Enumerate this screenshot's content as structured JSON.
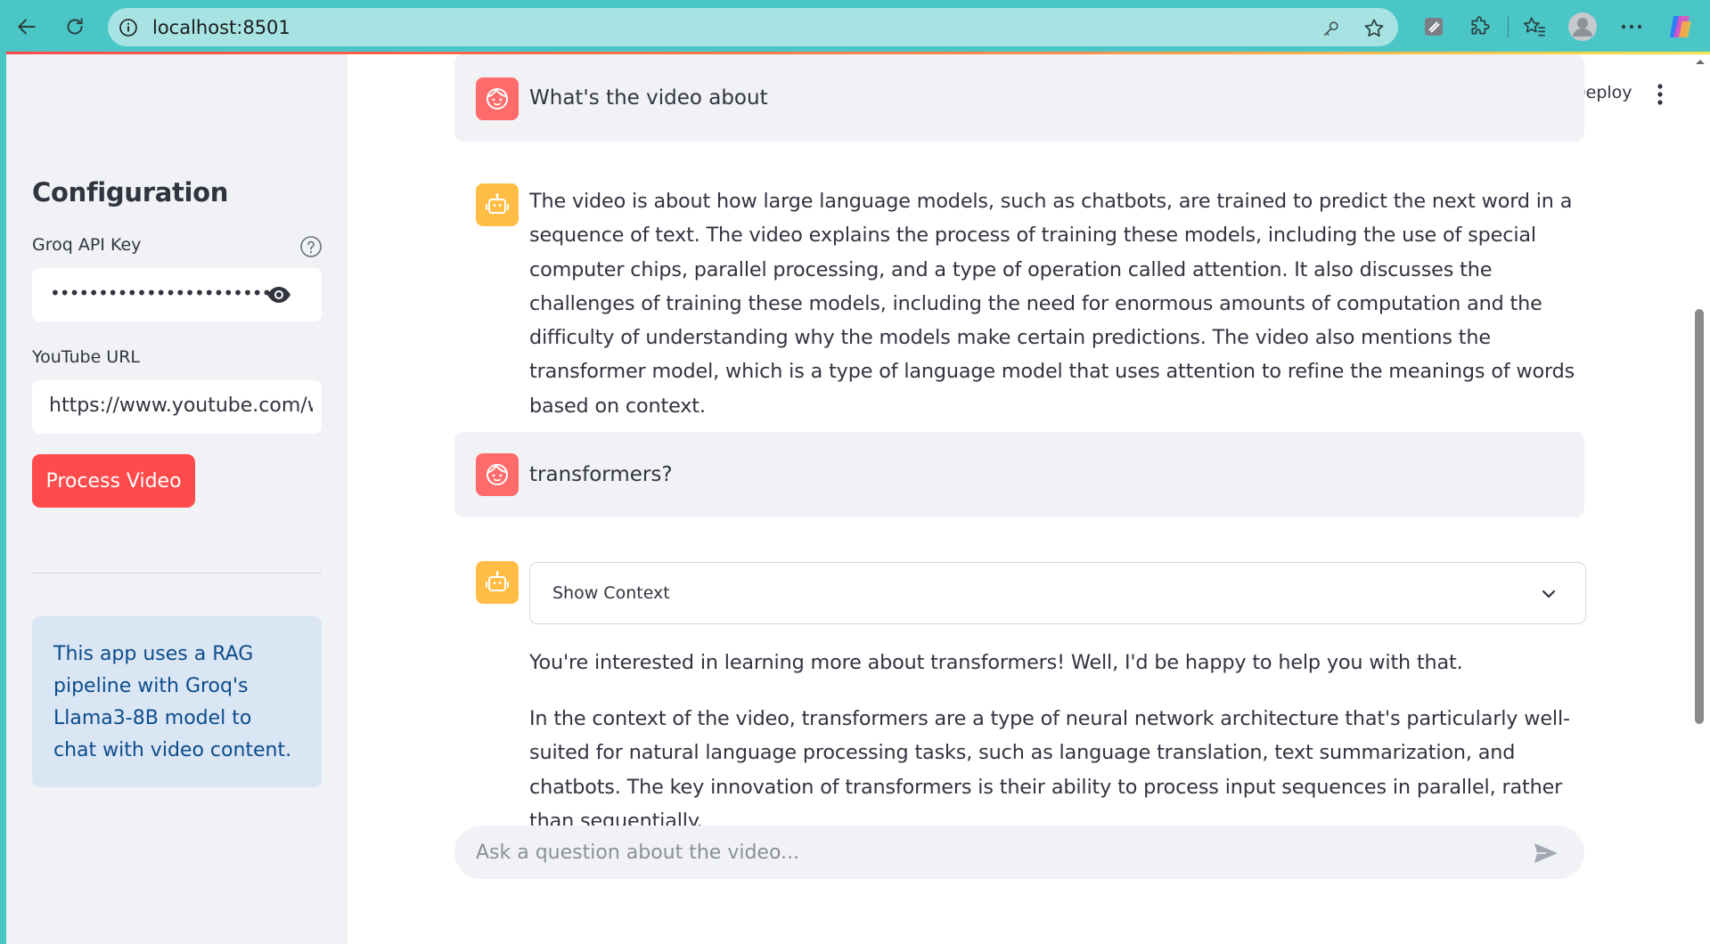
{
  "browser": {
    "url": "localhost:8501"
  },
  "sidebar": {
    "title": "Configuration",
    "api_key_label": "Groq API Key",
    "api_key_value": "••••••••••••••••••••••••••••••••••••••••",
    "youtube_label": "YouTube URL",
    "youtube_value": "https://www.youtube.com/watch?v=",
    "process_button": "Process Video",
    "info_text": "This app uses a RAG pipeline with Groq's Llama3-8B model to chat with video content."
  },
  "header": {
    "deploy": "Deploy"
  },
  "chat": {
    "messages": [
      {
        "role": "user",
        "text": "What's the video about"
      },
      {
        "role": "assistant",
        "text": "The video is about how large language models, such as chatbots, are trained to predict the next word in a sequence of text. The video explains the process of training these models, including the use of special computer chips, parallel processing, and a type of operation called attention. It also discusses the challenges of training these models, including the need for enormous amounts of computation and the difficulty of understanding why the models make certain predictions. The video also mentions the transformer model, which is a type of language model that uses attention to refine the meanings of words based on context."
      },
      {
        "role": "user",
        "text": "transformers?"
      },
      {
        "role": "assistant",
        "expander_label": "Show Context",
        "paragraphs": [
          "You're interested in learning more about transformers! Well, I'd be happy to help you with that.",
          "In the context of the video, transformers are a type of neural network architecture that's particularly well-suited for natural language processing tasks, such as language translation, text summarization, and chatbots. The key innovation of transformers is their ability to process input sequences in parallel, rather than sequentially."
        ]
      }
    ],
    "input_placeholder": "Ask a question about the video..."
  },
  "colors": {
    "primary": "#ff4b4b",
    "user_avatar": "#ff6b6b",
    "bot_avatar": "#ffbd45",
    "sidebar_bg": "#f0f2f6",
    "info_bg": "#dbe6f4",
    "info_text": "#0b4c8c",
    "browser_chrome": "#4bc6c6"
  }
}
